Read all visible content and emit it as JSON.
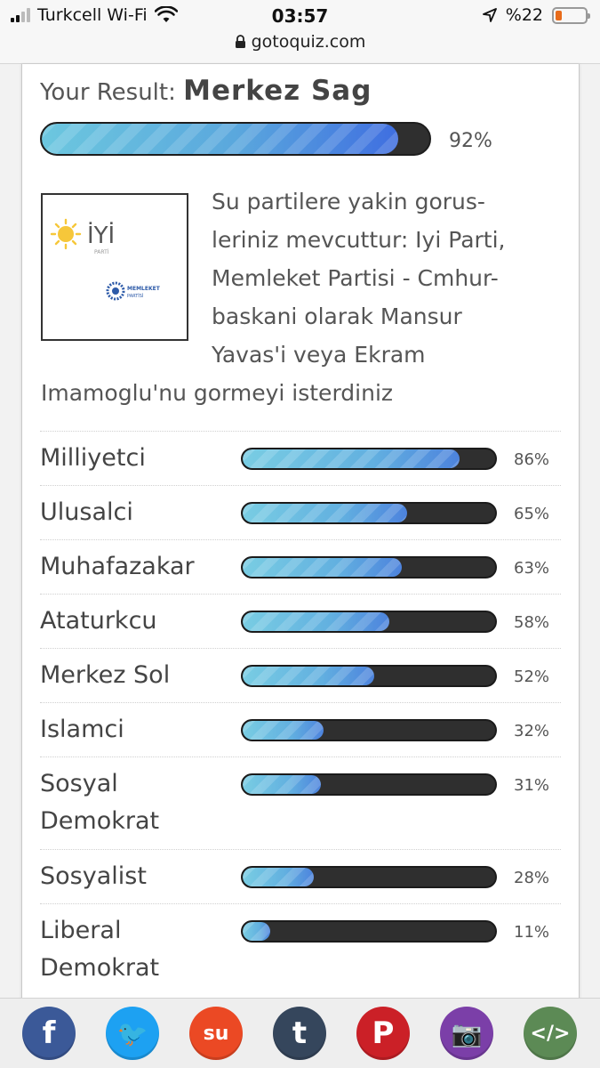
{
  "status_bar": {
    "carrier": "Turkcell Wi-Fi",
    "time": "03:57",
    "battery": "%22",
    "battery_level": 0.22,
    "url": "gotoquiz.com"
  },
  "result": {
    "prefix": "Your Result:",
    "name": "Merkez Sag",
    "percent_label": "92%",
    "percent": 92
  },
  "logo": {
    "iyi_text": "İYİ",
    "iyi_sub": "PARTİ",
    "memleket_text": "MEMLEKET",
    "memleket_sub": "PARTİSİ"
  },
  "description_lines": [
    "Su partilere yakin gorus-",
    "leriniz mevcuttur: Iyi Parti,",
    "Memleket Partisi - Cmhur-",
    "baskani olarak Mansur",
    "Yavas'i veya Ekram",
    "Imamoglu'nu gormeyi isterdiniz"
  ],
  "scores": [
    {
      "label": "Milliyetci",
      "percent": 86,
      "percent_label": "86%"
    },
    {
      "label": "Ulusalci",
      "percent": 65,
      "percent_label": "65%"
    },
    {
      "label": "Muhafazakar",
      "percent": 63,
      "percent_label": "63%"
    },
    {
      "label": "Ataturkcu",
      "percent": 58,
      "percent_label": "58%"
    },
    {
      "label": "Merkez Sol",
      "percent": 52,
      "percent_label": "52%"
    },
    {
      "label": "Islamci",
      "percent": 32,
      "percent_label": "32%"
    },
    {
      "label": "Sosyal Demokrat",
      "label_lines": [
        "Sosyal",
        "Demokrat"
      ],
      "percent": 31,
      "percent_label": "31%"
    },
    {
      "label": "Sosyalist",
      "percent": 28,
      "percent_label": "28%"
    },
    {
      "label": "Liberal Demokrat",
      "label_lines": [
        "Liberal",
        "Demokrat"
      ],
      "percent": 11,
      "percent_label": "11%"
    }
  ],
  "share_buttons": [
    {
      "name": "facebook-share-button",
      "icon": "facebook-icon",
      "glyph": "f",
      "color": "#3b5998"
    },
    {
      "name": "twitter-share-button",
      "icon": "twitter-icon",
      "glyph": "🐦",
      "color": "#1da1f2"
    },
    {
      "name": "stumbleupon-share-button",
      "icon": "stumbleupon-icon",
      "glyph": "su",
      "color": "#eb4924"
    },
    {
      "name": "tumblr-share-button",
      "icon": "tumblr-icon",
      "glyph": "t",
      "color": "#35465c"
    },
    {
      "name": "pinterest-share-button",
      "icon": "pinterest-icon",
      "glyph": "P",
      "color": "#cb2027"
    },
    {
      "name": "screenshot-share-button",
      "icon": "camera-icon",
      "glyph": "📷",
      "color": "#7b3fa8"
    },
    {
      "name": "embed-share-button",
      "icon": "code-icon",
      "glyph": "</>",
      "color": "#5c8a55"
    }
  ]
}
